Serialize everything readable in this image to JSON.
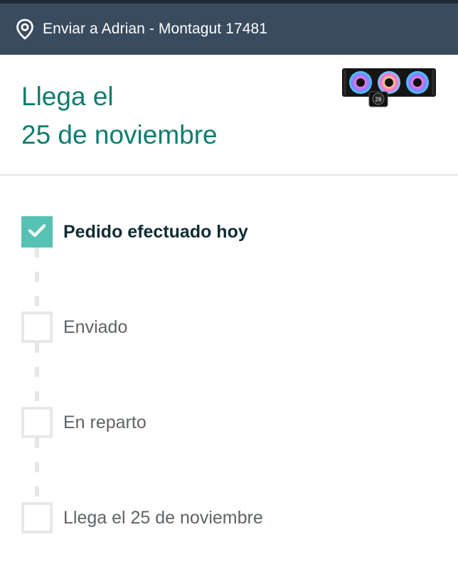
{
  "header": {
    "deliver_to": "Enviar a Adrian - Montagut 17481",
    "location_icon": "map-pin-icon"
  },
  "arrival": {
    "line1": "Llega el",
    "line2": "25 de noviembre"
  },
  "product": {
    "description": "AIO liquid cooler with three RGB fans and pump display",
    "pump_display_value": "28"
  },
  "tracking": {
    "steps": [
      {
        "label": "Pedido efectuado hoy",
        "completed": true
      },
      {
        "label": "Enviado",
        "completed": false
      },
      {
        "label": "En reparto",
        "completed": false
      },
      {
        "label": "Llega el 25 de noviembre",
        "completed": false
      }
    ]
  },
  "colors": {
    "header_bg": "#394b5e",
    "accent_green": "#0f7d6f",
    "check_green": "#55c2b3",
    "box_border": "#e8e8e8"
  }
}
